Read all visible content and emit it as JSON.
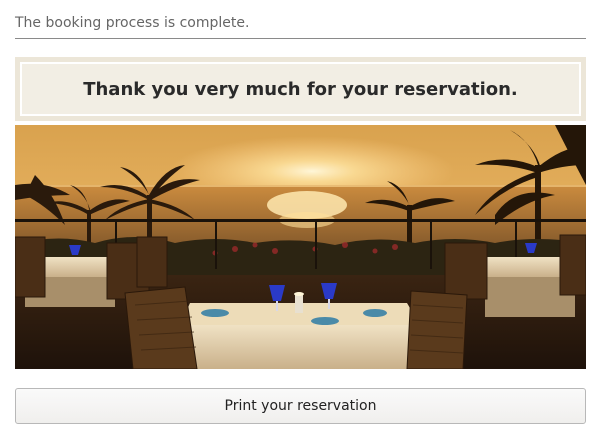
{
  "status": {
    "message": "The booking process is complete."
  },
  "confirmation": {
    "heading": "Thank you very much for your reservation."
  },
  "hero_image": {
    "icon": "restaurant-sunset-photo"
  },
  "actions": {
    "print_label": "Print your reservation"
  },
  "colors": {
    "heading_bg": "#f2eee4",
    "heading_border": "#ece6d8",
    "status_rule": "#8a8a8a"
  }
}
